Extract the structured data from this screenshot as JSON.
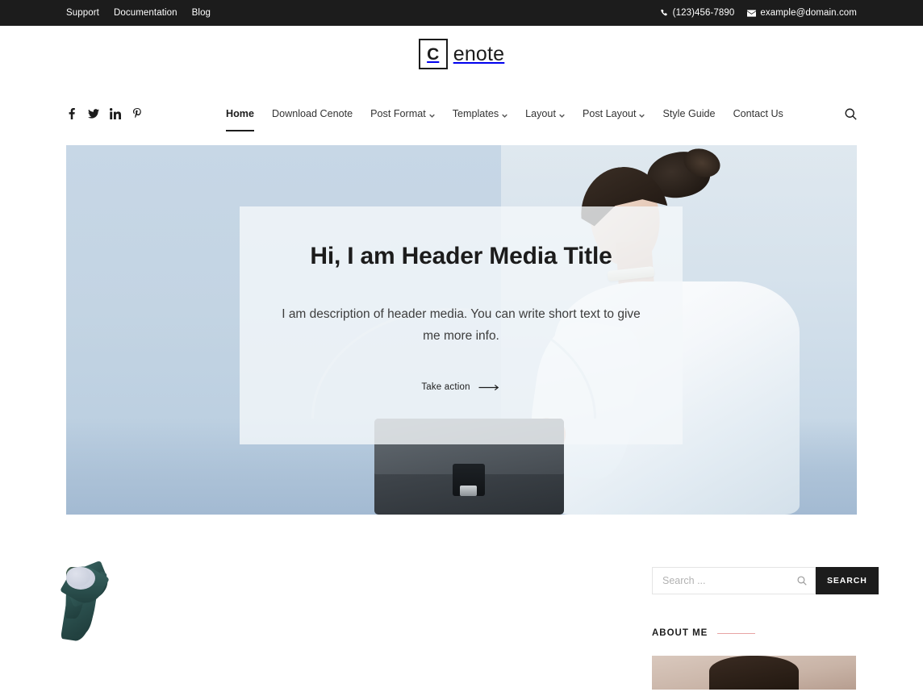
{
  "topbar": {
    "links": [
      {
        "label": "Support",
        "name": "topbar-link-support"
      },
      {
        "label": "Documentation",
        "name": "topbar-link-documentation"
      },
      {
        "label": "Blog",
        "name": "topbar-link-blog"
      }
    ],
    "phone": "(123)456-7890",
    "email": "example@domain.com",
    "phone_icon": "phone-icon",
    "email_icon": "envelope-icon"
  },
  "logo": {
    "mark": "C",
    "text": "enote",
    "full": "Cenote"
  },
  "social": [
    {
      "name": "facebook-icon",
      "label": "Facebook"
    },
    {
      "name": "twitter-icon",
      "label": "Twitter"
    },
    {
      "name": "linkedin-icon",
      "label": "LinkedIn"
    },
    {
      "name": "pinterest-icon",
      "label": "Pinterest"
    }
  ],
  "menu": [
    {
      "label": "Home",
      "active": true,
      "caret": false
    },
    {
      "label": "Download Cenote",
      "active": false,
      "caret": false
    },
    {
      "label": "Post Format",
      "active": false,
      "caret": true
    },
    {
      "label": "Templates",
      "active": false,
      "caret": true
    },
    {
      "label": "Layout",
      "active": false,
      "caret": true
    },
    {
      "label": "Post Layout",
      "active": false,
      "caret": true
    },
    {
      "label": "Style Guide",
      "active": false,
      "caret": false
    },
    {
      "label": "Contact Us",
      "active": false,
      "caret": false
    }
  ],
  "header_search_icon": "search-icon",
  "hero": {
    "title": "Hi, I am Header Media Title",
    "description": "I am description of header media. You can write short text to give me more info.",
    "cta_label": "Take action",
    "cta_icon": "arrow-right-icon",
    "background_color": "#c2d4e4",
    "overlay_color": "rgba(244,247,250,0.80)"
  },
  "sidebar": {
    "search": {
      "placeholder": "Search ...",
      "value": "",
      "button_label": "SEARCH",
      "icon": "search-icon",
      "button_color": "#1c1c1c"
    },
    "widgets": [
      {
        "title": "ABOUT ME",
        "accent_color": "#e8a4a4"
      }
    ]
  },
  "post": {
    "image_alt": "botanical branch with teal leaves on pale pink background"
  }
}
